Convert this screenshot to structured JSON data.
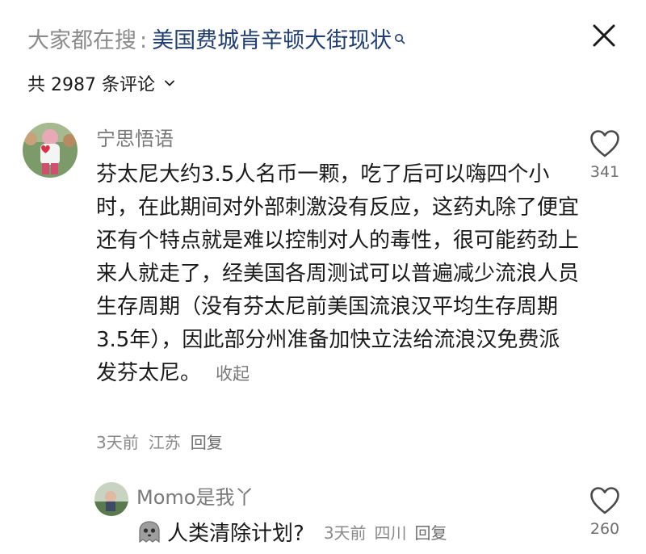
{
  "header": {
    "prefix": "大家都在搜",
    "separator": ":",
    "query": "美国费城肯辛顿大街现状",
    "query_icon": "search-icon",
    "close_icon": "close-icon"
  },
  "comments_count": {
    "label": "共 2987 条评论",
    "chevron_icon": "chevron-down-icon"
  },
  "comment": {
    "username": "宁思悟语",
    "text": "芬太尼大约3.5人名币一颗，吃了后可以嗨四个小时，在此期间对外部刺激没有反应，这药丸除了便宜还有个特点就是难以控制对人的毒性，很可能药劲上来人就走了，经美国各周测试可以普遍减少流浪人员生存周期（没有芬太尼前美国流浪汉平均生存周期3.5年），因此部分州准备加快立法给流浪汉免费派发芬太尼。",
    "collapse_label": "收起",
    "time": "3天前",
    "location": "江苏",
    "reply_label": "回复",
    "likes": "341"
  },
  "reply": {
    "username": "Momo是我丫",
    "text": "人类清除计划?",
    "time": "3天前",
    "location": "四川",
    "reply_label": "回复",
    "likes": "260"
  },
  "colors": {
    "query": "#213e6e",
    "muted": "#8a8a8a",
    "text": "#1a1a1a"
  }
}
